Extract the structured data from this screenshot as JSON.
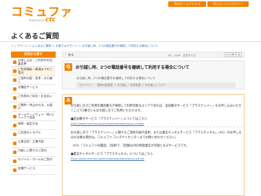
{
  "header": {
    "logo_main": "コミュファ",
    "logo_sub": "Powered by",
    "logo_ctc": "ctc",
    "home_button": "Webホームアドレス",
    "mycommufa_button": "Myコミュファログイン"
  },
  "page_title": "よくあるご質問",
  "breadcrumb": "トップページ ＞ よくあるご質問 ＞ お客さまサポート ＞ お引越し時、2つの電話番号を継続して利用する場合について",
  "sidebar": {
    "heading": "目的から探す",
    "items": [
      {
        "label": "お申し込み・ご利用中の名義変更",
        "icon": "person-icon"
      },
      {
        "label": "ご利用開始・開通までのご案内",
        "icon": "home-icon"
      },
      {
        "label": "ご契約内容・変更・お引越し",
        "icon": "document-icon"
      },
      {
        "label": "光電話サービス",
        "icon": "phone-icon"
      },
      {
        "label": "ご利用のご料金・お支払い",
        "icon": "yen-icon"
      },
      {
        "label": "ご解約・休止の方法、お届け",
        "icon": "close-icon"
      },
      {
        "label": "ホームゲートウェイ・Myコミュファ認証",
        "icon": "router-icon"
      },
      {
        "label": "接続・設定方法",
        "icon": "wrench-icon"
      },
      {
        "label": "ご利用のトラブル",
        "icon": "alert-icon"
      },
      {
        "label": "工事日程・工事内容",
        "icon": "calendar-icon"
      },
      {
        "label": "引越しに関するご案内",
        "icon": "truck-icon"
      },
      {
        "label": "モバイル・ホームのご案内",
        "icon": "mobile-icon"
      },
      {
        "label": "各種サービス",
        "icon": "grid-icon"
      }
    ]
  },
  "back_label": "戻る",
  "meta": "ID：1199　文字サイズ",
  "font_buttons": [
    "小",
    "中",
    "大"
  ],
  "question": {
    "badge": "Q",
    "title": "お引越し時、2つの電話番号を継続して利用する場合について",
    "text": "お引越し時、2つの電話番号を継続して利用する場合について",
    "category": "カテゴリー：　契約内容変更 ＞ お引越し・住所変更 ＞ お引越しについて"
  },
  "answer": {
    "badge": "A",
    "p1": "お引越し先がご利用の電話番号が継続して利用可能なエリアであれば、追加番号サービス「プラスナンバー」をお申し込みいただくことで2番号ともお引越し先でご利用いただけます。",
    "item1": "■追加番号サービス「プラスナンバー」についてはこちら",
    "link1": "https://www.commufa.jp/service/phone/option/plus-number",
    "p2": "お引越し先で「プラスナンバー」に関するご契約内容の変更、または着信チャネルサービス「プラスチャネル」（※1）のお申し込みが必要な場合は、コミュファ コンタクトセンターまでお問い合わせください。",
    "note": "（※1）「コミュファ光電話」1契約で、2回線分の同時発着信が可能となるサービスです。",
    "item2": "■着信チャネルサービス「プラスチャネル」についてはこちら",
    "link2": "https://www.commufa.jp/service/phone/option/plus-channel"
  },
  "colors": {
    "accent": "#f08300",
    "link": "#3a6fb0"
  }
}
